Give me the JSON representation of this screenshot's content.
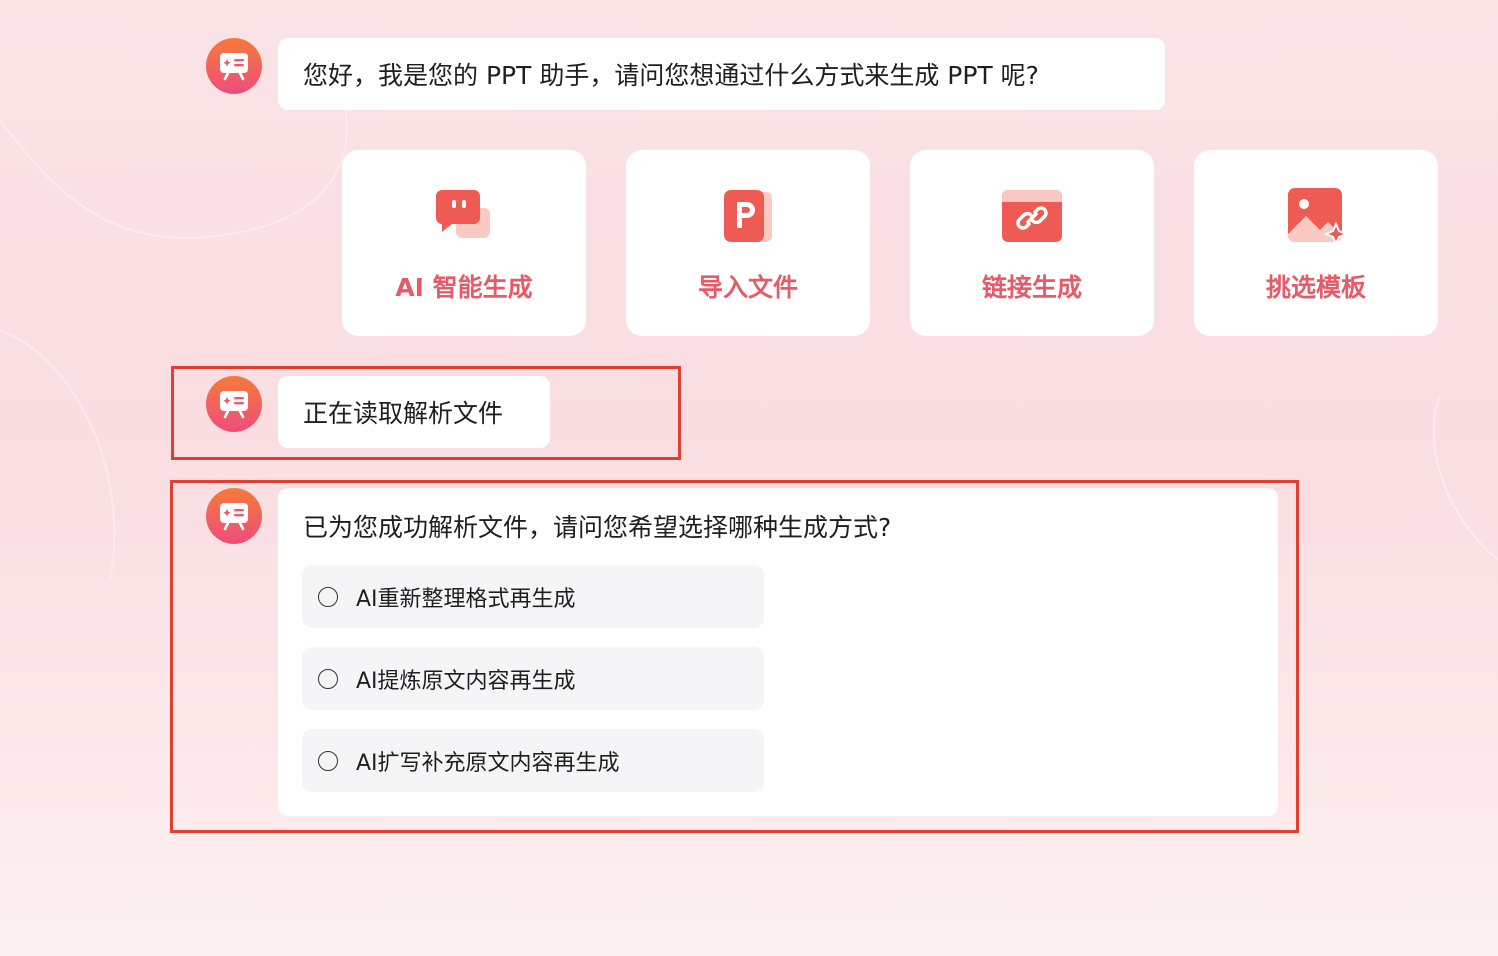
{
  "chat": {
    "greeting": "您好，我是您的 PPT 助手，请问您想通过什么方式来生成 PPT 呢?",
    "reading_status": "正在读取解析文件",
    "parsed_prompt": "已为您成功解析文件，请问您希望选择哪种生成方式?"
  },
  "methods": [
    {
      "label": "AI 智能生成",
      "icon": "chat-bubble-icon"
    },
    {
      "label": "导入文件",
      "icon": "powerpoint-file-icon"
    },
    {
      "label": "链接生成",
      "icon": "link-icon"
    },
    {
      "label": "挑选模板",
      "icon": "image-template-icon"
    }
  ],
  "options": [
    {
      "label": "AI重新整理格式再生成"
    },
    {
      "label": "AI提炼原文内容再生成"
    },
    {
      "label": "AI扩写补充原文内容再生成"
    }
  ],
  "colors": {
    "accent": "#e55b68",
    "highlight_border": "#e0402f",
    "avatar_top": "#f57a3a",
    "avatar_bottom": "#ee4d7c"
  }
}
